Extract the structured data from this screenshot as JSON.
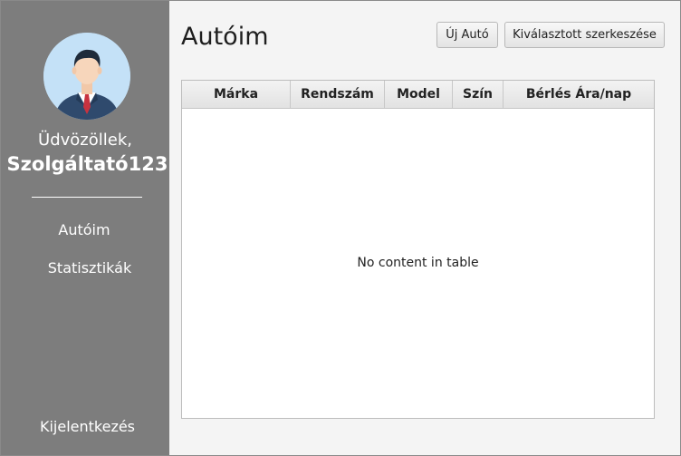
{
  "sidebar": {
    "avatar_icon": "user-avatar-icon",
    "welcome": "Üdvözöllek,",
    "username": "Szolgáltató123",
    "nav": {
      "my_cars": "Autóim",
      "statistics": "Statisztikák"
    },
    "logout": "Kijelentkezés"
  },
  "main": {
    "title": "Autóim",
    "buttons": {
      "new_car": "Új Autó",
      "edit_selected": "Kiválasztott szerkeszése"
    },
    "table": {
      "columns": [
        "Márka",
        "Rendszám",
        "Model",
        "Szín",
        "Bérlés Ára/nap"
      ],
      "empty_text": "No content in table"
    }
  },
  "colors": {
    "sidebar_bg": "#7d7d7d",
    "content_bg": "#f4f4f4",
    "avatar_bg": "#c4e1f7",
    "suit": "#2f4a6d",
    "tie": "#c8323f"
  }
}
